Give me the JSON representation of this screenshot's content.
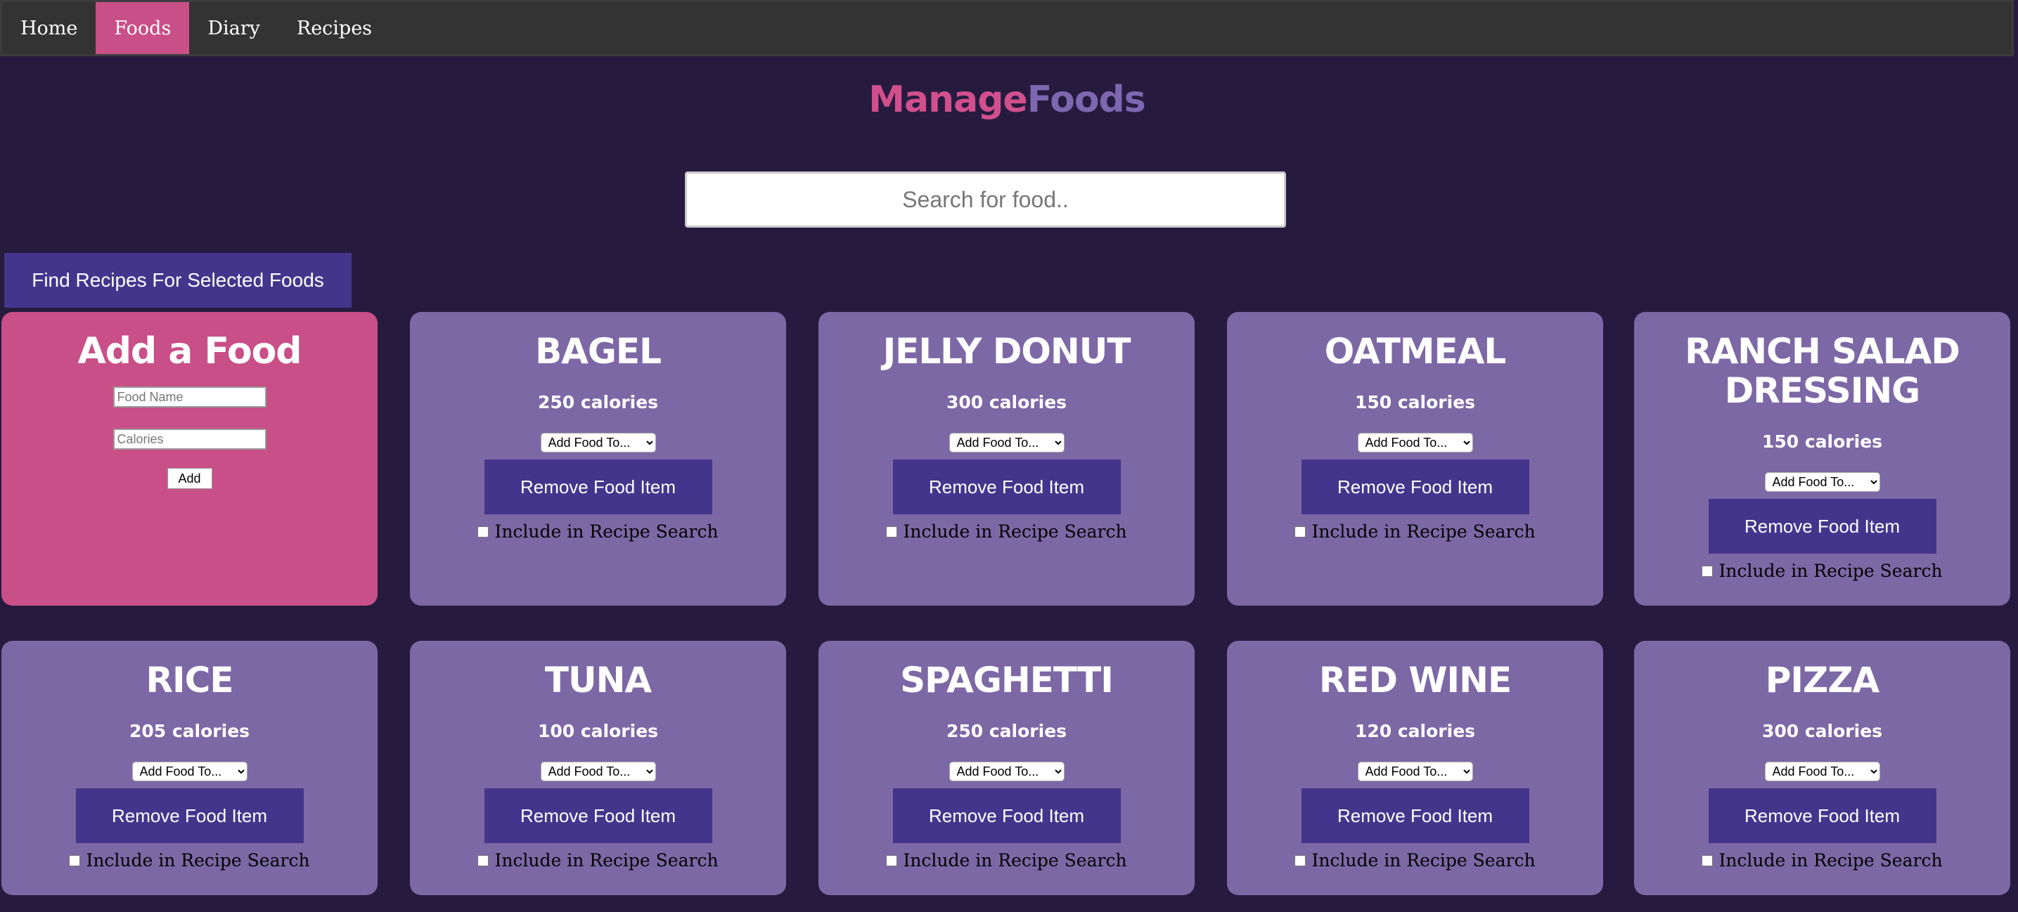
{
  "nav": {
    "items": [
      {
        "label": "Home",
        "active": false
      },
      {
        "label": "Foods",
        "active": true
      },
      {
        "label": "Diary",
        "active": false
      },
      {
        "label": "Recipes",
        "active": false
      }
    ]
  },
  "title": {
    "part1": "Manage",
    "part2": "Foods",
    "part1_color": "#d14f8d",
    "part2_color": "#7c67b0"
  },
  "search": {
    "placeholder": "Search for food..",
    "value": ""
  },
  "find_button_label": "Find Recipes For Selected Foods",
  "add_food": {
    "title": "Add a Food",
    "name_placeholder": "Food Name",
    "calories_placeholder": "Calories",
    "add_label": "Add"
  },
  "card_controls": {
    "select_label": "Add Food To...",
    "remove_label": "Remove Food Item",
    "include_label": "Include in Recipe Search"
  },
  "foods": [
    {
      "name": "Bagel",
      "calories": "250 calories"
    },
    {
      "name": "Jelly Donut",
      "calories": "300 calories"
    },
    {
      "name": "Oatmeal",
      "calories": "150 calories"
    },
    {
      "name": "Ranch Salad Dressing",
      "calories": "150 calories"
    },
    {
      "name": "Rice",
      "calories": "205 calories"
    },
    {
      "name": "Tuna",
      "calories": "100 calories"
    },
    {
      "name": "Spaghetti",
      "calories": "250 calories"
    },
    {
      "name": "Red Wine",
      "calories": "120 calories"
    },
    {
      "name": "Pizza",
      "calories": "300 calories"
    }
  ],
  "colors": {
    "background": "#261b3e",
    "navbar": "#333333",
    "accent_pink": "#c94f88",
    "card_purple": "#7d68a6",
    "button_purple": "#44358c"
  }
}
